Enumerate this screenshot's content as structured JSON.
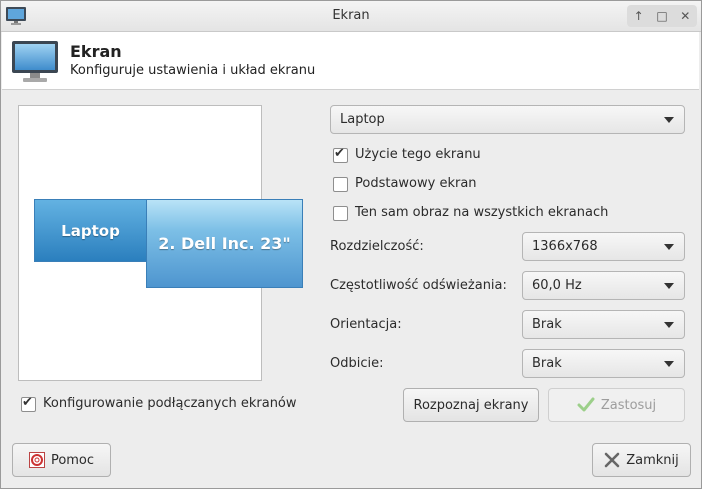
{
  "window": {
    "title": "Ekran"
  },
  "header": {
    "title": "Ekran",
    "subtitle": "Konfiguruje ustawienia i układ ekranu"
  },
  "preview": {
    "monitors": [
      {
        "label": "Laptop"
      },
      {
        "label": "2. Dell Inc. 23\""
      }
    ]
  },
  "settings": {
    "output_select": "Laptop",
    "use_display": {
      "label": "Użycie tego ekranu",
      "checked": true
    },
    "primary": {
      "label": "Podstawowy ekran",
      "checked": false
    },
    "mirror": {
      "label": "Ten sam obraz na wszystkich ekranach",
      "checked": false
    },
    "resolution": {
      "label": "Rozdzielczość:",
      "value": "1366x768"
    },
    "refresh": {
      "label": "Częstotliwość odświeżania:",
      "value": "60,0 Hz"
    },
    "orientation": {
      "label": "Orientacja:",
      "value": "Brak"
    },
    "reflection": {
      "label": "Odbicie:",
      "value": "Brak"
    }
  },
  "auto_configure": {
    "label": "Konfigurowanie podłączanych ekranów",
    "checked": true
  },
  "buttons": {
    "identify": "Rozpoznaj ekrany",
    "apply": "Zastosuj",
    "help": "Pomoc",
    "close": "Zamknij"
  },
  "icons": {
    "app": "monitor-icon",
    "help": "lifebuoy-icon",
    "apply": "checkmark-icon",
    "close": "x-icon"
  }
}
